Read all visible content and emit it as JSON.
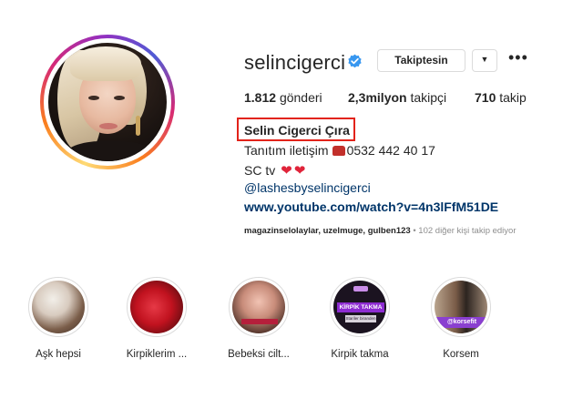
{
  "profile": {
    "username": "selincigerci",
    "verified": true,
    "follow_button_label": "Takiptesin",
    "dropdown_icon": "caret-down-icon",
    "more_icon": "more-options-icon",
    "stats": {
      "posts_count": "1.812",
      "posts_label": "gönderi",
      "followers_count": "2,3milyon",
      "followers_label": "takipçi",
      "following_count": "710",
      "following_label": "takip"
    },
    "full_name": "Selin Cigerci Çıra",
    "bio": {
      "line1": "Tanıtım iletişim",
      "phone": "0532 442 40 17",
      "line2": "SC tv",
      "mention": "@lashesbyselincigerci",
      "url": "www.youtube.com/watch?v=4n3lFfM51DE"
    },
    "followed_by": {
      "names": "magazinselolaylar, uzelmuge, gulben123",
      "suffix": " • 102 diğer kişi takip ediyor"
    },
    "colors": {
      "verified_blue": "#3897f0",
      "link_blue": "#003569",
      "highlight_box_red": "#e2231a",
      "heart_red": "#e0243a"
    }
  },
  "highlights": [
    {
      "label": "Aşk hepsi",
      "overlay": ""
    },
    {
      "label": "Kirpiklerim ...",
      "overlay": ""
    },
    {
      "label": "Bebeksi cilt...",
      "overlay": ""
    },
    {
      "label": "Kirpik takma",
      "overlay": "KİRPİK TAKMA",
      "overlay_sub": "Stariler biranden"
    },
    {
      "label": "Korsem",
      "overlay": "@korsefit"
    }
  ]
}
